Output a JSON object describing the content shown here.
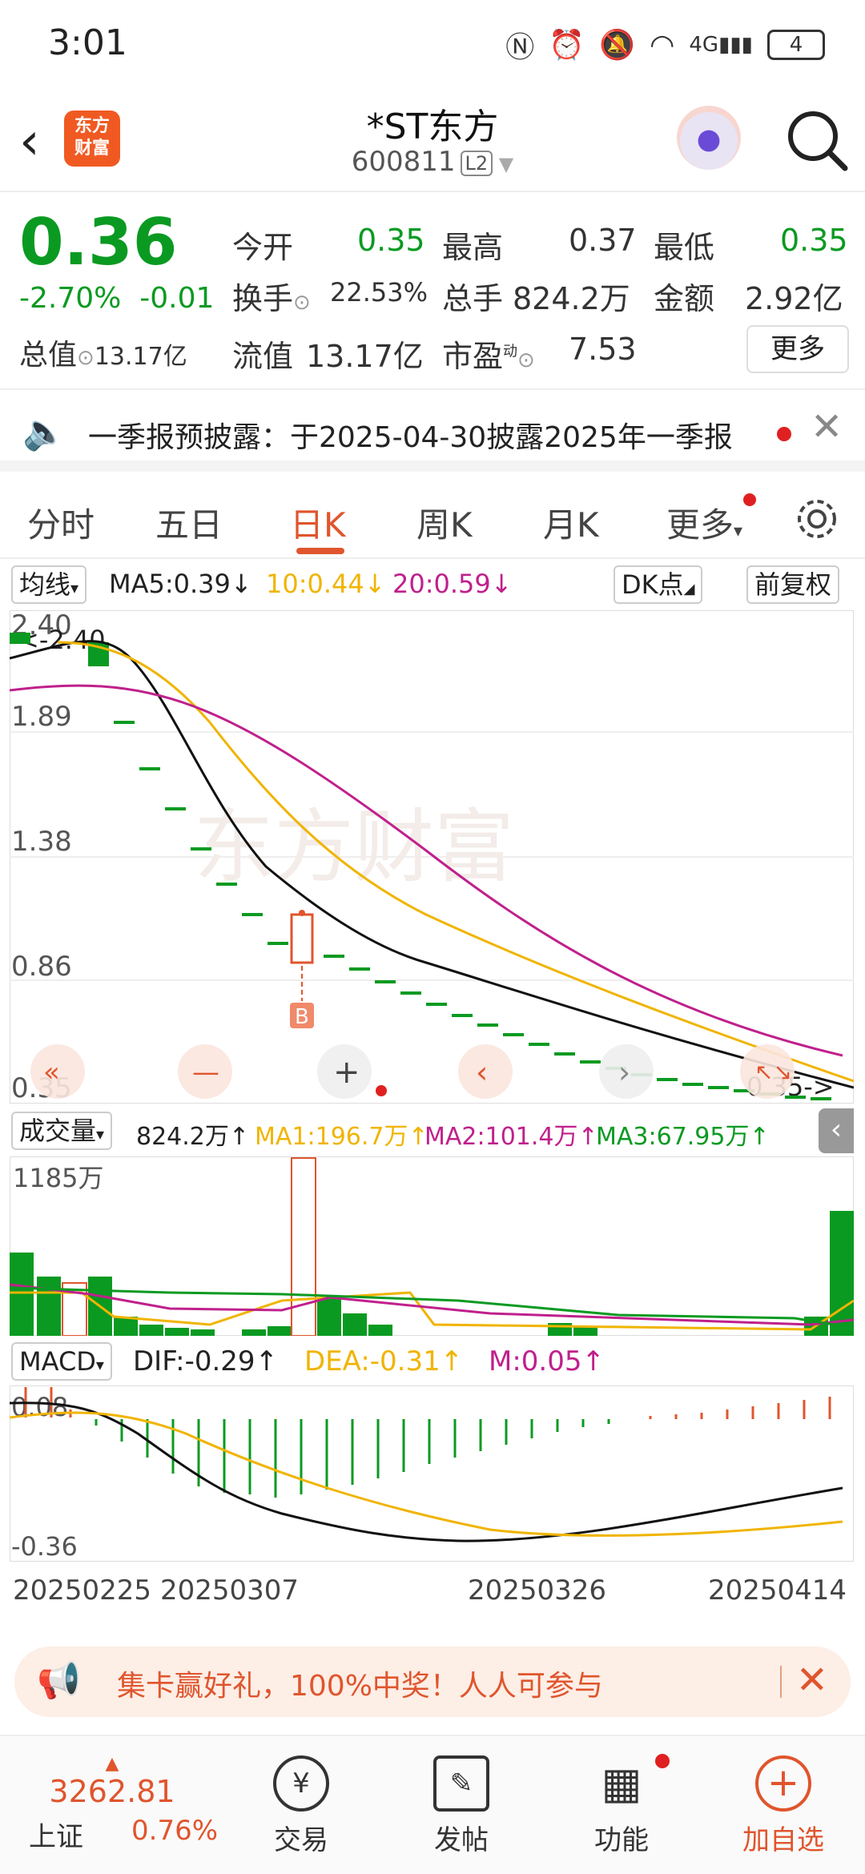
{
  "status": {
    "time": "3:01",
    "battery": "4",
    "net": "4G"
  },
  "header": {
    "title": "*ST东方",
    "code": "600811",
    "l2": "L2",
    "logo": "东方\n财富"
  },
  "quote": {
    "price": "0.36",
    "pct": "-2.70%",
    "delta": "-0.01",
    "open_label": "今开",
    "open": "0.35",
    "high_label": "最高",
    "high": "0.37",
    "low_label": "最低",
    "low": "0.35",
    "turnover_label": "换手",
    "turnover": "22.53%",
    "volume_label": "总手",
    "volume": "824.2万",
    "amount_label": "金额",
    "amount": "2.92亿",
    "mcap_label": "总值",
    "mcap": "13.17亿",
    "float_label": "流值",
    "float": "13.17亿",
    "pe_label": "市盈",
    "pe_sup": "动",
    "pe": "7.53",
    "more": "更多"
  },
  "notice": {
    "text": "一季报预披露：于2025-04-30披露2025年一季报"
  },
  "tabs": [
    "分时",
    "五日",
    "日K",
    "周K",
    "月K",
    "更多"
  ],
  "active_tab": "日K",
  "ma": {
    "label": "均线",
    "ma5": "MA5:0.39",
    "ma10": "10:0.44",
    "ma20": "20:0.59",
    "dk": "DK点",
    "fq": "前复权"
  },
  "kchart": {
    "y_labels": [
      "2.40",
      "1.89",
      "1.38",
      "0.86",
      "0.35"
    ],
    "max_label": "<-2.40",
    "min_label": "0.35->",
    "marker": "B",
    "watermark": "东方财富"
  },
  "volume": {
    "label": "成交量",
    "value": "824.2万",
    "ma1": "MA1:196.7万",
    "ma2": "MA2:101.4万",
    "ma3": "MA3:67.95万",
    "ymax": "1185万"
  },
  "macd": {
    "label": "MACD",
    "dif": "DIF:-0.29",
    "dea": "DEA:-0.31",
    "m": "M:0.05",
    "ymax": "0.08",
    "ymin": "-0.36"
  },
  "dates": [
    "20250225",
    "20250307",
    "20250326",
    "20250414"
  ],
  "banner": {
    "text": "集卡赢好礼，100%中奖！人人可参与"
  },
  "bottom": {
    "index_value": "3262.81",
    "index_name": "上证",
    "index_pct": "0.76%",
    "trade": "交易",
    "post": "发帖",
    "func": "功能",
    "add": "加自选"
  },
  "colors": {
    "green": "#0a9a21",
    "red": "#e0552d",
    "ma10": "#f0b400",
    "ma20": "#c0208c"
  }
}
